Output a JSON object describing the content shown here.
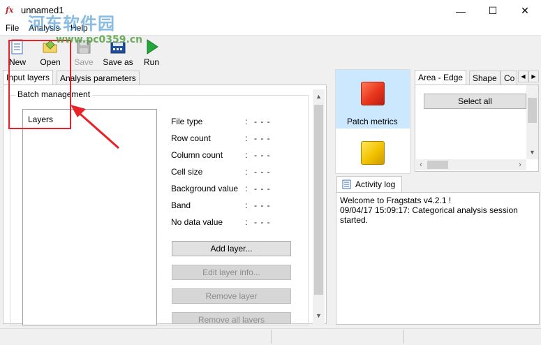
{
  "window": {
    "title": "unnamed1",
    "app_icon": "fragstats-icon",
    "controls": [
      "minimize",
      "maximize",
      "close"
    ],
    "minimize_glyph": "—",
    "maximize_glyph": "☐",
    "close_glyph": "✕"
  },
  "menu": {
    "items": [
      {
        "label": "File"
      },
      {
        "label": "Analysis"
      },
      {
        "label": "Help"
      }
    ]
  },
  "toolbar": {
    "new_label": "New",
    "open_label": "Open",
    "save_label": "Save",
    "save_as_label": "Save as",
    "run_label": "Run"
  },
  "left_tabs": [
    {
      "label": "Input layers"
    },
    {
      "label": "Analysis parameters"
    }
  ],
  "batch": {
    "title": "Batch management",
    "layers_header": "Layers",
    "info": [
      {
        "label": "File type",
        "value": "- - -"
      },
      {
        "label": "Row count",
        "value": "- - -"
      },
      {
        "label": "Column count",
        "value": "- - -"
      },
      {
        "label": "Cell size",
        "value": "- - -"
      },
      {
        "label": "Background value",
        "value": "- - -"
      },
      {
        "label": "Band",
        "value": "- - -"
      },
      {
        "label": "No data value",
        "value": "- - -"
      }
    ],
    "colon": ":",
    "buttons": {
      "add": "Add layer...",
      "edit": "Edit layer info...",
      "remove": "Remove layer",
      "remove_all": "Remove all layers"
    }
  },
  "metrics": {
    "patch_label": "Patch metrics"
  },
  "right_tabs": [
    {
      "label": "Area - Edge"
    },
    {
      "label": "Shape"
    },
    {
      "label": "Co"
    }
  ],
  "select_all_label": "Select all",
  "activity": {
    "tab_label": "Activity log",
    "text": "Welcome to Fragstats v4.2.1 !\n09/04/17 15:09:17: Categorical analysis session started."
  },
  "watermark": {
    "text": "河东软件园",
    "url": "www.pc0359.cn"
  },
  "colors": {
    "annotation_red": "#e8222a",
    "selection_blue": "#cce8ff",
    "patch_red": "#e8351c",
    "class_yellow": "#f2c200"
  }
}
